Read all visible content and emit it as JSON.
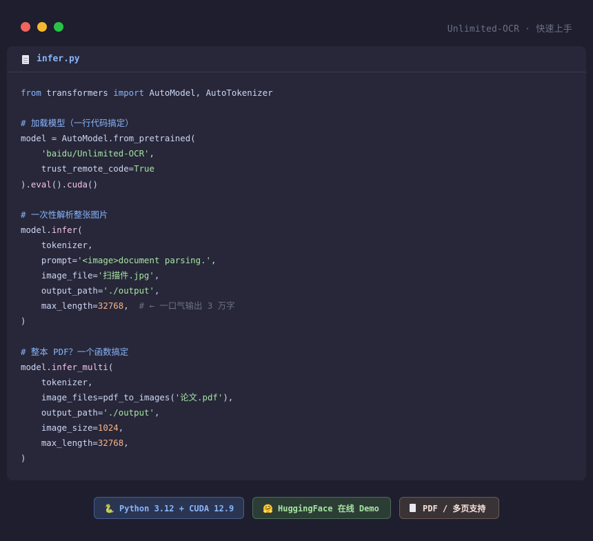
{
  "window": {
    "title": "Unlimited-OCR · 快速上手"
  },
  "tab": {
    "filename": "infer.py",
    "icon": "file-icon"
  },
  "code_lines": [
    [
      {
        "t": "from",
        "c": "kw"
      },
      {
        "t": " transformers "
      },
      {
        "t": "import",
        "c": "kw"
      },
      {
        "t": " AutoModel, AutoTokenizer"
      }
    ],
    [],
    [
      {
        "t": "# 加载模型（一行代码搞定）",
        "c": "cm"
      }
    ],
    [
      {
        "t": "model = AutoModel.from_pretrained("
      }
    ],
    [
      {
        "t": "    "
      },
      {
        "t": "'baidu/Unlimited-OCR'",
        "c": "str"
      },
      {
        "t": ","
      }
    ],
    [
      {
        "t": "    trust_remote_code="
      },
      {
        "t": "True",
        "c": "bool"
      }
    ],
    [
      {
        "t": ")."
      },
      {
        "t": "eval",
        "c": "fn"
      },
      {
        "t": "()."
      },
      {
        "t": "cuda",
        "c": "fn"
      },
      {
        "t": "()"
      }
    ],
    [],
    [
      {
        "t": "# 一次性解析整张图片",
        "c": "cm"
      }
    ],
    [
      {
        "t": "model."
      },
      {
        "t": "infer",
        "c": "fn"
      },
      {
        "t": "("
      }
    ],
    [
      {
        "t": "    tokenizer,"
      }
    ],
    [
      {
        "t": "    prompt="
      },
      {
        "t": "'<image>document parsing.'",
        "c": "str"
      },
      {
        "t": ","
      }
    ],
    [
      {
        "t": "    image_file="
      },
      {
        "t": "'扫描件.jpg'",
        "c": "str"
      },
      {
        "t": ","
      }
    ],
    [
      {
        "t": "    output_path="
      },
      {
        "t": "'./output'",
        "c": "str"
      },
      {
        "t": ","
      }
    ],
    [
      {
        "t": "    max_length="
      },
      {
        "t": "32768",
        "c": "num"
      },
      {
        "t": ",  "
      },
      {
        "t": "# ← 一口气输出 3 万字",
        "c": "cm2"
      }
    ],
    [
      {
        "t": ")"
      }
    ],
    [],
    [
      {
        "t": "# 整本 PDF？一个函数搞定",
        "c": "cm"
      }
    ],
    [
      {
        "t": "model."
      },
      {
        "t": "infer_multi",
        "c": "fn"
      },
      {
        "t": "("
      }
    ],
    [
      {
        "t": "    tokenizer,"
      }
    ],
    [
      {
        "t": "    image_files=pdf_to_images("
      },
      {
        "t": "'论文.pdf'",
        "c": "str"
      },
      {
        "t": "),"
      }
    ],
    [
      {
        "t": "    output_path="
      },
      {
        "t": "'./output'",
        "c": "str"
      },
      {
        "t": ","
      }
    ],
    [
      {
        "t": "    image_size="
      },
      {
        "t": "1024",
        "c": "num"
      },
      {
        "t": ","
      }
    ],
    [
      {
        "t": "    max_length="
      },
      {
        "t": "32768",
        "c": "num"
      },
      {
        "t": ","
      }
    ],
    [
      {
        "t": ")"
      }
    ]
  ],
  "badges": [
    {
      "label": "Python 3.12 + CUDA 12.9",
      "icon": "python-icon",
      "glyph": "🐍"
    },
    {
      "label": "HuggingFace 在线 Demo",
      "icon": "huggingface-icon",
      "glyph": "🤗"
    },
    {
      "label": "PDF / 多页支持",
      "icon": "document-icon"
    }
  ],
  "colors": {
    "background": "#1e1e2e",
    "panel": "#272739",
    "keyword": "#89b4fa",
    "string": "#a6e3a1",
    "number": "#fab387",
    "function": "#f5c2e7",
    "close": "#f2645e",
    "minimize": "#f4b830",
    "maximize": "#29c246"
  }
}
